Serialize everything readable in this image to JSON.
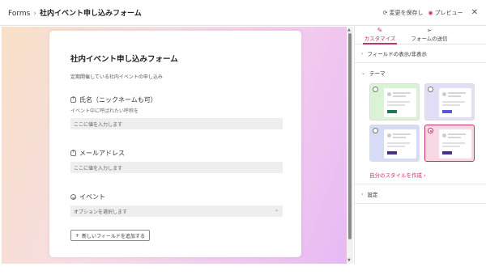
{
  "topbar": {
    "breadcrumb_root": "Forms",
    "breadcrumb_sep": "›",
    "title": "社内イベント申し込みフォーム",
    "save_label": "変更を保存し",
    "preview_label": "プレビュー",
    "close_icon": "close-icon"
  },
  "form": {
    "title": "社内イベント申し込みフォーム",
    "description": "定期開催している社内イベントの申し込み",
    "questions": [
      {
        "label": "氏名（ニックネームも可）",
        "subtitle": "イベント中に呼ばれたい呼称を",
        "placeholder": "ここに値を入力します",
        "icon": "text-field-icon"
      },
      {
        "label": "メールアドレス",
        "placeholder": "ここに値を入力します",
        "icon": "text-field-icon"
      },
      {
        "label": "イベント",
        "placeholder": "オプションを選択します",
        "icon": "choice-icon"
      }
    ],
    "add_field_label": "新しいフィールドを追加する"
  },
  "panel": {
    "tabs": [
      {
        "label": "カスタマイズ",
        "icon": "paintbrush-icon",
        "active": true
      },
      {
        "label": "フォームの送信",
        "icon": "send-icon",
        "active": false
      }
    ],
    "field_visibility_label": "フィールドの表示/非表示",
    "theme_label": "テーマ",
    "own_style_label": "自分のスタイルを作成",
    "own_style_chevron": "›",
    "settings_label": "設定",
    "themes": [
      {
        "name": "green",
        "bg": "#d9f3d4",
        "accent": "#1f7a52",
        "selected": false
      },
      {
        "name": "lavender",
        "bg": "#e2def7",
        "accent": "#5b57d6",
        "selected": false
      },
      {
        "name": "blue-purple",
        "bg": "#d6dcf6",
        "accent": "#4a2f8f",
        "selected": false
      },
      {
        "name": "pink-peach",
        "bg": "#f7d9e6",
        "accent": "#4a2f8f",
        "selected": true
      }
    ]
  },
  "colors": {
    "accent": "#c4326c"
  }
}
